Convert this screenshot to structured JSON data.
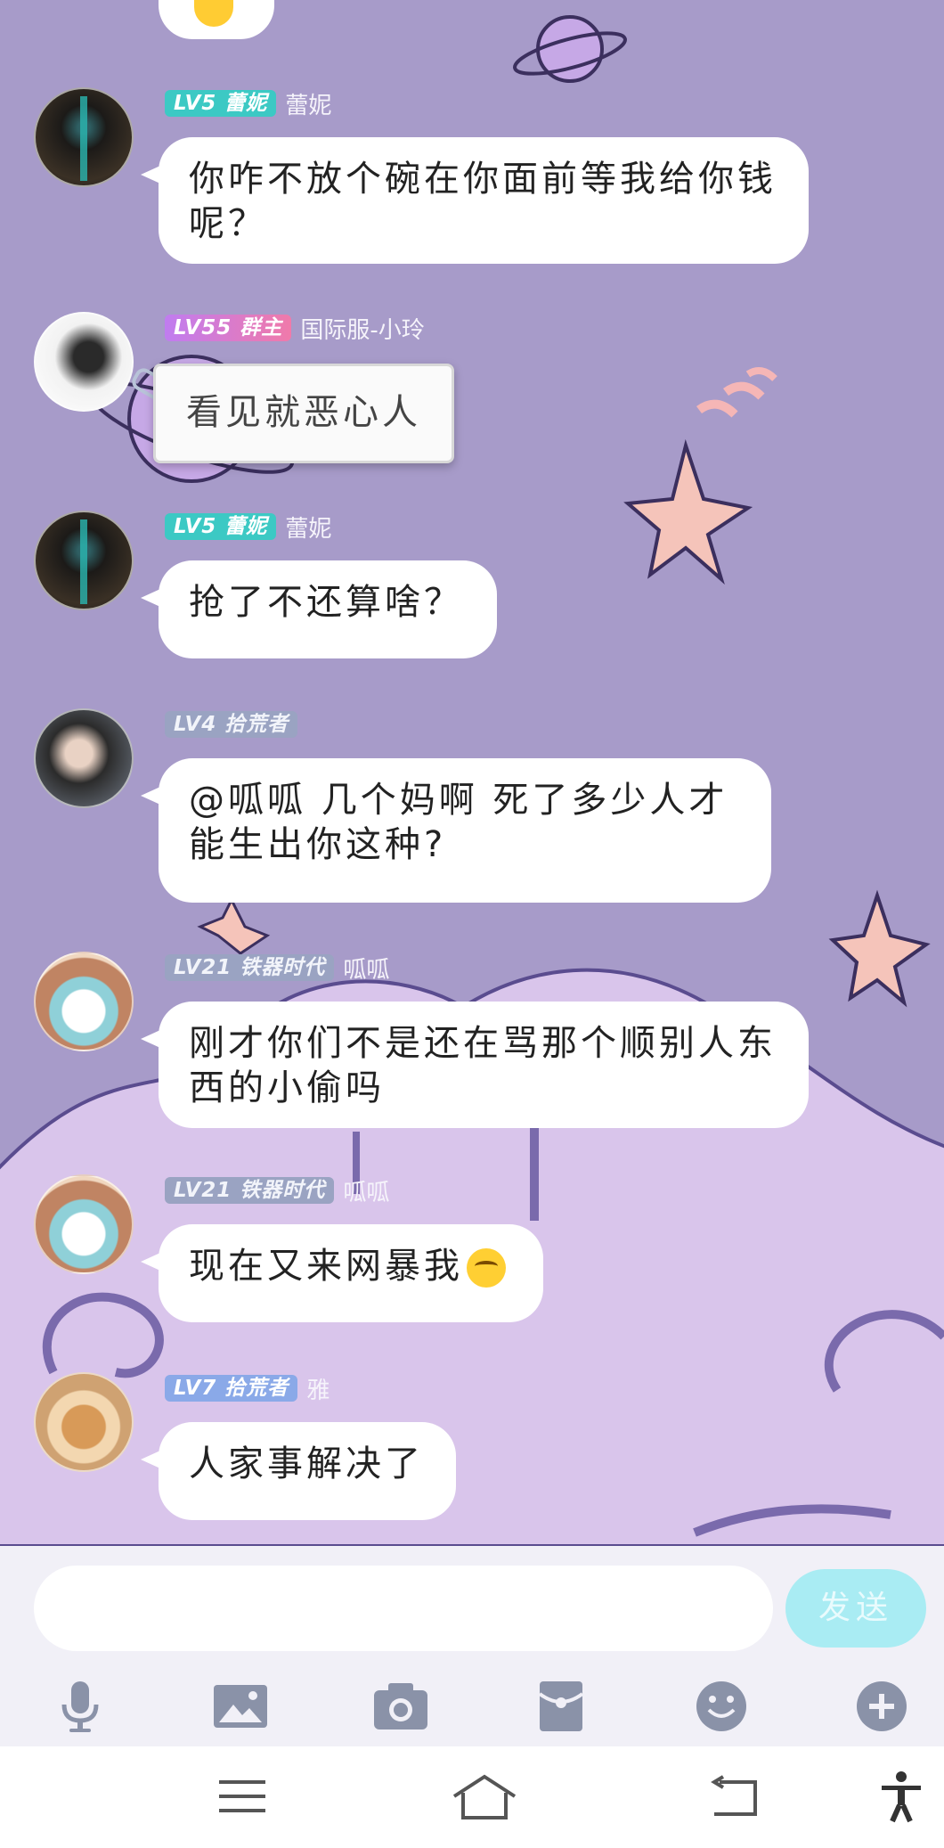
{
  "messages": [
    {
      "level": "LV5 蕾妮",
      "name": "蕾妮",
      "text": "你咋不放个碗在你面前等我给你钱呢？"
    },
    {
      "level": "LV55 群主",
      "name": "国际服-小玲",
      "text": "看见就恶心人"
    },
    {
      "level": "LV5 蕾妮",
      "name": "蕾妮",
      "text": "抢了不还算啥？"
    },
    {
      "level": "LV4 拾荒者",
      "name": "",
      "text": "@呱呱 几个妈啊 死了多少人才能生出你这种?"
    },
    {
      "level": "LV21 铁器时代",
      "name": "呱呱",
      "text": "刚才你们不是还在骂那个顺别人东西的小偷吗"
    },
    {
      "level": "LV21 铁器时代",
      "name": "呱呱",
      "text": "现在又来网暴我",
      "emoji": "smirk-emoji"
    },
    {
      "level": "LV7 拾荒者",
      "name": "雅",
      "text": "人家事解决了"
    }
  ],
  "composer": {
    "placeholder": "",
    "send_label": "发送",
    "tools": [
      "microphone-icon",
      "image-icon",
      "camera-icon",
      "red-packet-icon",
      "emoji-icon",
      "plus-icon"
    ]
  },
  "navbar": {
    "buttons": [
      "menu-icon",
      "home-icon",
      "back-icon",
      "accessibility-icon"
    ]
  },
  "colors": {
    "background": "#a79bc9",
    "bubble": "#ffffff",
    "send_button": "#a9ecf3",
    "badge_teal": "#3cc9c4",
    "badge_pink": "#e07ad0",
    "badge_gray": "#9aa3c2",
    "badge_blue": "#8aa9e8"
  }
}
